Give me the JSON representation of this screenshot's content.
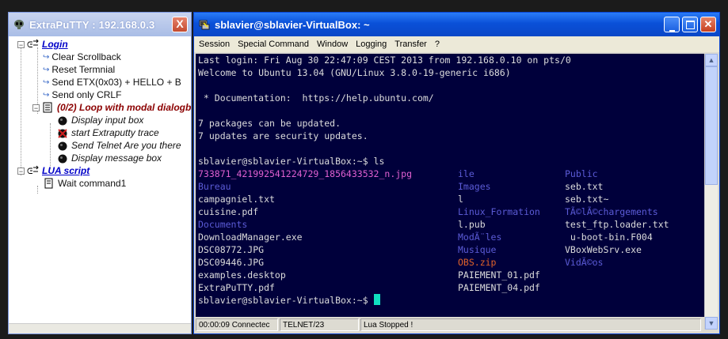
{
  "left_window": {
    "title": "ExtraPuTTY : 192.168.0.3",
    "close": "X",
    "tree": {
      "login": "Login",
      "clear_scrollback": "Clear Scrollback",
      "reset_terminal": "Reset Termnial",
      "send_etx": "Send ETX(0x03) + HELLO + B",
      "send_crlf": "Send only CRLF",
      "loop": "(0/2) Loop with modal dialogb",
      "display_input_box": "Display input box",
      "start_trace": "start Extraputty trace",
      "send_telnet": "Send Telnet Are you there",
      "display_message_box": "Display message box",
      "lua_script": "LUA script",
      "wait_command": "Wait command1"
    }
  },
  "right_window": {
    "title": "sblavier@sblavier-VirtualBox: ~",
    "menu": [
      "Session",
      "Special Command",
      "Window",
      "Logging",
      "Transfer",
      "?"
    ],
    "terminal": {
      "line1": "Last login: Fri Aug 30 22:47:09 CEST 2013 from 192.168.0.10 on pts/0",
      "line2": "Welcome to Ubuntu 13.04 (GNU/Linux 3.8.0-19-generic i686)",
      "line3": " * Documentation:  https://help.ubuntu.com/",
      "line4": "7 packages can be updated.",
      "line5": "7 updates are security updates.",
      "prompt_ls": "sblavier@sblavier-VirtualBox:~$ ls",
      "ls_rows": [
        [
          "733871_421992541224729_1856433532_n.jpg",
          "ile",
          "Public"
        ],
        [
          "Bureau",
          "Images",
          "seb.txt"
        ],
        [
          "campagniel.txt",
          "l",
          "seb.txt~"
        ],
        [
          "cuisine.pdf",
          "Linux_Formation",
          "TÃ©lÃ©chargements"
        ],
        [
          "Documents",
          "l.pub",
          "test_ftp.loader.txt"
        ],
        [
          "DownloadManager.exe",
          "ModÃ¨les",
          " u-boot-bin.F004"
        ],
        [
          "DSC08772.JPG",
          "Musique",
          "VBoxWebSrv.exe"
        ],
        [
          "DSC09446.JPG",
          "OBS.zip",
          "VidÃ©os"
        ],
        [
          "examples.desktop",
          "PAIEMENT_01.pdf",
          ""
        ],
        [
          "ExtraPuTTY.pdf",
          "PAIEMENT_04.pdf",
          ""
        ]
      ],
      "ls_colors": [
        [
          "pink",
          "blue",
          "blue"
        ],
        [
          "blue",
          "blue",
          "white"
        ],
        [
          "white",
          "white",
          "white"
        ],
        [
          "white",
          "blue",
          "blue"
        ],
        [
          "blue",
          "white",
          "white"
        ],
        [
          "white",
          "blue",
          "white"
        ],
        [
          "white",
          "blue",
          "white"
        ],
        [
          "white",
          "red",
          "blue"
        ],
        [
          "white",
          "white",
          "white"
        ],
        [
          "white",
          "white",
          "white"
        ]
      ],
      "prompt_final": "sblavier@sblavier-VirtualBox:~$ "
    },
    "status": {
      "time": "00:00:09 Connectec",
      "protocol": "TELNET/23",
      "lua": "Lua Stopped !"
    }
  },
  "colors": {
    "terminal_bg": "#00003b",
    "pink": "#e060d0",
    "blue": "#5b5bd6",
    "red": "#e0622a",
    "cursor": "#10e0c0"
  }
}
